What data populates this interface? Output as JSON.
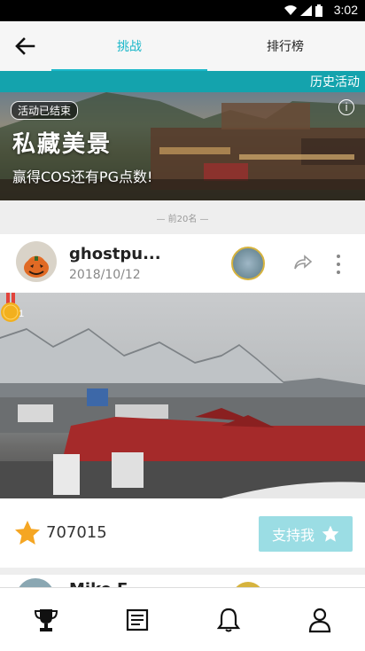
{
  "status_bar": {
    "time": "3:02",
    "icons": [
      "wifi-icon",
      "signal-icon",
      "battery-icon"
    ]
  },
  "app_bar": {
    "back_icon": "arrow-left-icon",
    "tabs": [
      {
        "label": "挑战",
        "active": true
      },
      {
        "label": "排行榜",
        "active": false
      }
    ]
  },
  "history_link": "历史活动",
  "banner": {
    "badge": "活动已结束",
    "title": "私藏美景",
    "subtitle": "赢得COS还有PG点数!",
    "info_icon": "info-icon"
  },
  "section_label": "— 前20名 —",
  "entry": {
    "username": "ghostpu...",
    "date": "2018/10/12",
    "rank": "1",
    "score": "707015",
    "support_label": "支持我",
    "icons": {
      "share": "share-icon",
      "more": "more-vert-icon",
      "star": "star-icon",
      "support_star": "star-outline-icon"
    }
  },
  "next_entry": {
    "username": "Mike F..."
  },
  "bottom_nav": [
    {
      "name": "trophy-icon",
      "active": true
    },
    {
      "name": "list-icon",
      "active": false
    },
    {
      "name": "bell-icon",
      "active": false
    },
    {
      "name": "profile-icon",
      "active": false
    }
  ],
  "colors": {
    "accent": "#1bb7c9",
    "teal_bar": "#14a3ad",
    "support_button": "#9bdde4",
    "star": "#f5a623",
    "medal": "#f2b01e"
  }
}
